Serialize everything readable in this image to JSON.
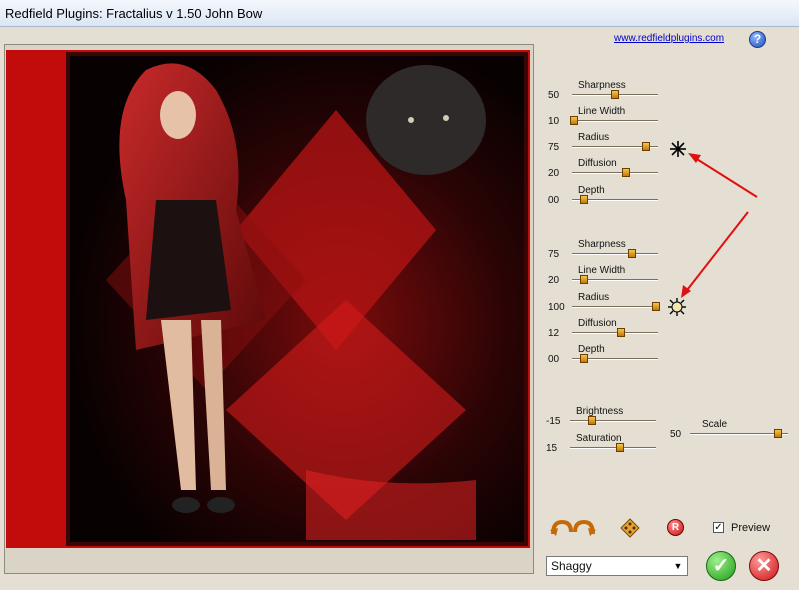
{
  "window": {
    "title": "Redfield Plugins: Fractalius v 1.50   John Bow"
  },
  "header": {
    "link": "www.redfieldplugins.com",
    "help_label": "?"
  },
  "group1": {
    "sharpness": {
      "label": "Sharpness",
      "value": "50",
      "level": 0.5
    },
    "line_width": {
      "label": "Line Width",
      "value": "10",
      "level": 0.02
    },
    "radius": {
      "label": "Radius",
      "value": "75",
      "level": 0.86
    },
    "diffusion": {
      "label": "Diffusion",
      "value": "20",
      "level": 0.63
    },
    "depth": {
      "label": "Depth",
      "value": "00",
      "level": 0.14
    }
  },
  "group2": {
    "sharpness": {
      "label": "Sharpness",
      "value": "75",
      "level": 0.7
    },
    "line_width": {
      "label": "Line Width",
      "value": "20",
      "level": 0.14
    },
    "radius": {
      "label": "Radius",
      "value": "100",
      "level": 0.98
    },
    "diffusion": {
      "label": "Diffusion",
      "value": "12",
      "level": 0.57
    },
    "depth": {
      "label": "Depth",
      "value": "00",
      "level": 0.14
    }
  },
  "adjust": {
    "brightness": {
      "label": "Brightness",
      "value": "-15",
      "level": 0.26
    },
    "saturation": {
      "label": "Saturation",
      "value": "15",
      "level": 0.58
    },
    "scale": {
      "label": "Scale",
      "value": "50",
      "level": 0.9
    }
  },
  "controls": {
    "preview_label": "Preview",
    "preview_checked": "✓",
    "preset_value": "Shaggy",
    "preset_arrow": "▼",
    "ok_label": "✓",
    "cancel_label": "✕",
    "reset_label": "R"
  },
  "colors": {
    "thumb": "#e8a01c",
    "arrow": "#e01010",
    "link": "#0000cc"
  }
}
